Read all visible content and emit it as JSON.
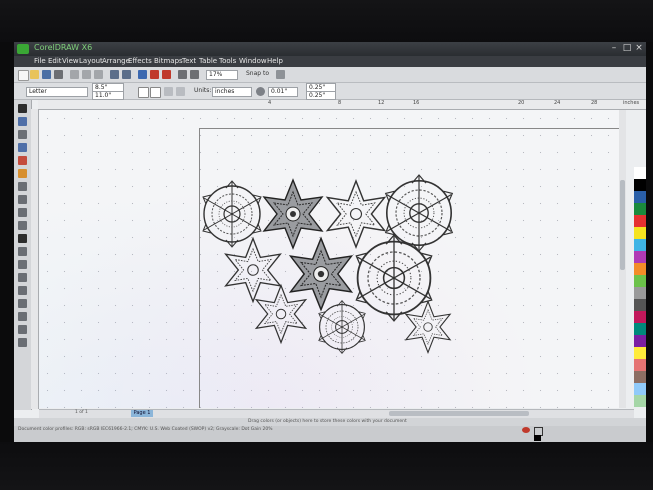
{
  "app": {
    "title": "CorelDRAW X6",
    "window_controls": [
      "–",
      "□",
      "×"
    ]
  },
  "menu": [
    "File",
    "Edit",
    "View",
    "Layout",
    "Arrange",
    "Effects",
    "Bitmaps",
    "Text",
    "Table",
    "Tools",
    "Window",
    "Help"
  ],
  "toolbar": {
    "zoom_value": "17%",
    "snap_label": "Snap to"
  },
  "property_bar": {
    "paper_select": "Letter",
    "width": "8.5\"",
    "height": "11.0\"",
    "units_label": "Units:",
    "units_value": "inches",
    "nudge": "0.01\"",
    "dup_x": "0.25\"",
    "dup_y": "0.25\""
  },
  "ruler": {
    "top_ticks": [
      "4",
      "8",
      "12",
      "16",
      "20",
      "24",
      "28"
    ],
    "units_label": "inches"
  },
  "pages": {
    "indicator": "1 of 1",
    "tab_label": "Page 1"
  },
  "status": {
    "hint": "Drag colors (or objects) here to store these colors with your document",
    "details": "Document color profiles: RGB: sRGB IEC61966-2.1; CMYK: U.S. Web Coated (SWOP) v2; Grayscale: Dot Gain 20%"
  },
  "palette_colors": [
    "#ffffff",
    "#000000",
    "#2a5fa8",
    "#1a8a3c",
    "#e53030",
    "#f5e320",
    "#3fb4e5",
    "#b03ab5",
    "#f28c28",
    "#6cc24a",
    "#9a9a9a",
    "#555555",
    "#c2185b",
    "#00897b",
    "#7b1fa2",
    "#ffeb3b",
    "#e57373",
    "#8d6e63",
    "#90caf9",
    "#a5d6a7"
  ],
  "colors": {
    "accent": "#3aa735",
    "canvas": "#f4f5f7"
  },
  "icons": {
    "shapes": [
      "snowflake-icon",
      "star-icon"
    ]
  }
}
